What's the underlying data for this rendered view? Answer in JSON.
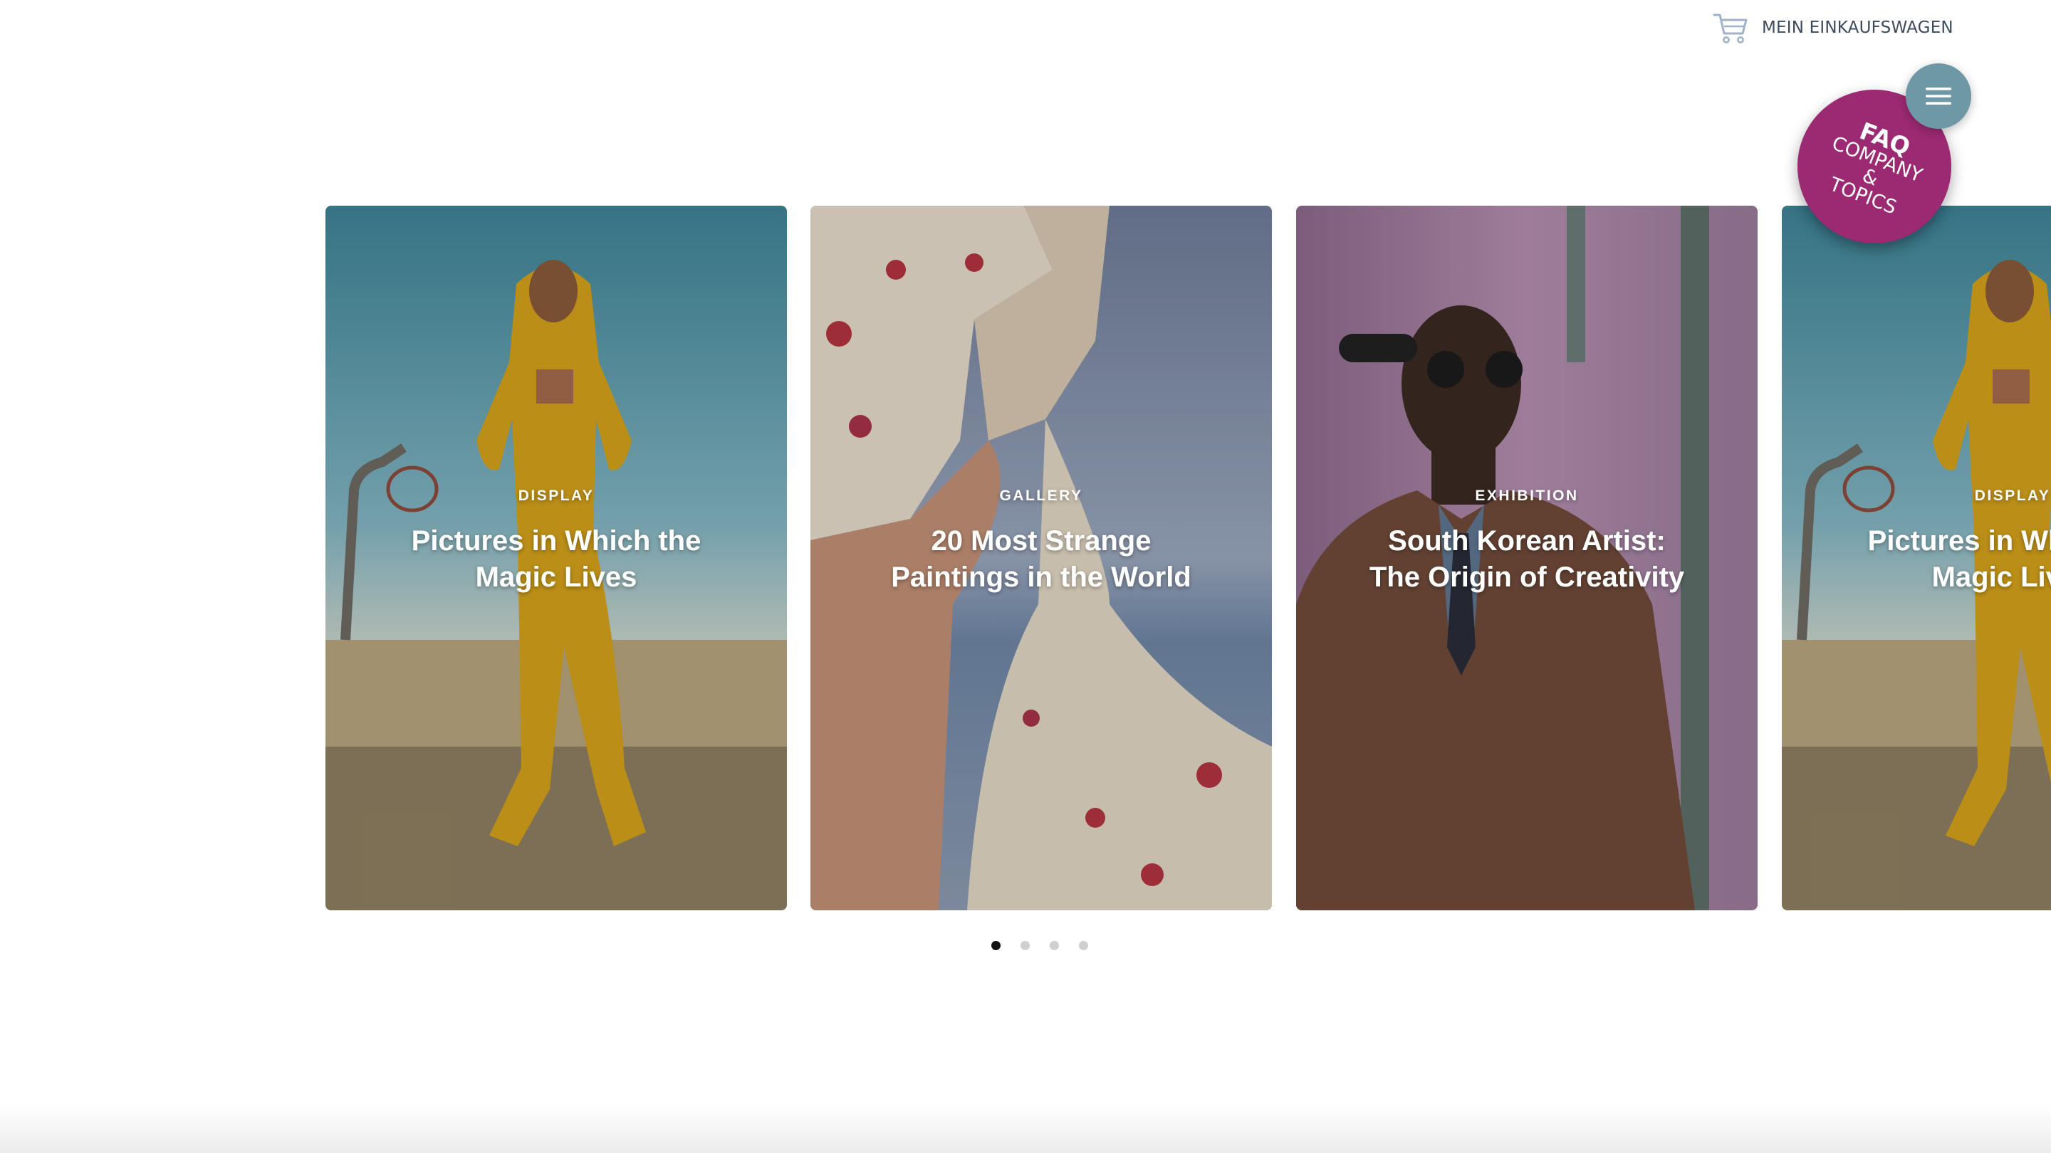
{
  "header": {
    "cart_label": "MEIN EINKAUFSWAGEN",
    "cart_icon": "shopping-cart-icon",
    "menu_icon": "hamburger-menu-icon"
  },
  "faq_badge": {
    "title": "FAQ",
    "line1": "COMPANY",
    "line2": "&",
    "line3": "TOPICS",
    "color": "#9c2a72"
  },
  "carousel": {
    "cards": [
      {
        "category": "DISPLAY",
        "title": "Pictures in Which the Magic Lives",
        "image": "woman-yellow-tracksuit-basketball-court"
      },
      {
        "category": "GALLERY",
        "title": "20 Most Strange Paintings in the World",
        "image": "floral-dress-closeup"
      },
      {
        "category": "EXHIBITION",
        "title": "South Korean Artist: The Origin of Creativity",
        "image": "man-sunglasses-leather-jacket"
      },
      {
        "category": "DISPLAY",
        "title": "Pictures in Which the Magic Lives",
        "image": "woman-yellow-tracksuit-basketball-court"
      }
    ],
    "pagination": {
      "total": 4,
      "active": 1
    }
  },
  "colors": {
    "menu_button": "#6f98a6",
    "badge": "#9c2a72",
    "active_dot": "#111111",
    "inactive_dot": "#cfcfcf"
  }
}
